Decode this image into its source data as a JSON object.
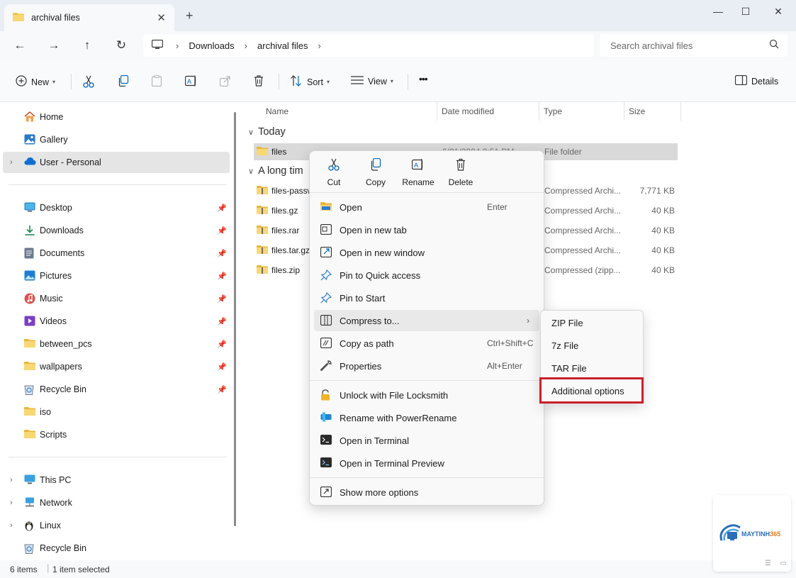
{
  "window": {
    "tab_title": "archival files",
    "new_tab": "+",
    "minimize": "—",
    "maximize": "☐",
    "close": "✕"
  },
  "address": {
    "crumbs": [
      "Downloads",
      "archival files"
    ],
    "search_placeholder": "Search archival files"
  },
  "toolbar": {
    "new_label": "New",
    "sort_label": "Sort",
    "view_label": "View",
    "more_label": "•••",
    "details_label": "Details"
  },
  "sidebar": {
    "top": [
      {
        "label": "Home",
        "icon": "home-icon"
      },
      {
        "label": "Gallery",
        "icon": "gallery-icon"
      },
      {
        "label": "User - Personal",
        "icon": "cloud-icon"
      }
    ],
    "pinned": [
      {
        "label": "Desktop",
        "icon": "desktop-icon"
      },
      {
        "label": "Downloads",
        "icon": "download-icon"
      },
      {
        "label": "Documents",
        "icon": "document-icon"
      },
      {
        "label": "Pictures",
        "icon": "pictures-icon"
      },
      {
        "label": "Music",
        "icon": "music-icon"
      },
      {
        "label": "Videos",
        "icon": "videos-icon"
      },
      {
        "label": "between_pcs",
        "icon": "folder-icon"
      },
      {
        "label": "wallpapers",
        "icon": "folder-icon"
      },
      {
        "label": "Recycle Bin",
        "icon": "recycle-bin-icon"
      },
      {
        "label": "iso",
        "icon": "folder-icon"
      },
      {
        "label": "Scripts",
        "icon": "folder-icon"
      }
    ],
    "bottom": [
      {
        "label": "This PC",
        "icon": "pc-icon"
      },
      {
        "label": "Network",
        "icon": "network-icon"
      },
      {
        "label": "Linux",
        "icon": "linux-icon"
      },
      {
        "label": "Recycle Bin",
        "icon": "recycle-bin-icon"
      }
    ]
  },
  "columns": {
    "name": "Name",
    "date": "Date modified",
    "type": "Type",
    "size": "Size"
  },
  "groups": {
    "today": "Today",
    "long_ago": "A long tim"
  },
  "files": {
    "today": [
      {
        "name": "files",
        "date": "6/21/2024 3:51 PM",
        "type": "File folder",
        "size": ""
      }
    ],
    "older": [
      {
        "name": "files-passw",
        "type": "Compressed Archi...",
        "size": "7,771 KB"
      },
      {
        "name": "files.gz",
        "type": "Compressed Archi...",
        "size": "40 KB"
      },
      {
        "name": "files.rar",
        "type": "Compressed Archi...",
        "size": "40 KB"
      },
      {
        "name": "files.tar.gz",
        "type": "Compressed Archi...",
        "size": "40 KB"
      },
      {
        "name": "files.zip",
        "type": "Compressed (zipp...",
        "size": "40 KB"
      }
    ]
  },
  "status": {
    "items": "6 items",
    "selected": "1 item selected"
  },
  "context_menu": {
    "quick": [
      {
        "label": "Cut",
        "icon": "cut-icon"
      },
      {
        "label": "Copy",
        "icon": "copy-icon"
      },
      {
        "label": "Rename",
        "icon": "rename-icon"
      },
      {
        "label": "Delete",
        "icon": "delete-icon"
      }
    ],
    "group1": [
      {
        "label": "Open",
        "shortcut": "Enter",
        "icon": "open-folder-icon"
      },
      {
        "label": "Open in new tab",
        "shortcut": "",
        "icon": "new-tab-icon"
      },
      {
        "label": "Open in new window",
        "shortcut": "",
        "icon": "new-window-icon"
      },
      {
        "label": "Pin to Quick access",
        "shortcut": "",
        "icon": "pin-icon"
      },
      {
        "label": "Pin to Start",
        "shortcut": "",
        "icon": "pin-icon"
      },
      {
        "label": "Compress to...",
        "shortcut": "",
        "icon": "compress-icon"
      },
      {
        "label": "Copy as path",
        "shortcut": "Ctrl+Shift+C",
        "icon": "copy-path-icon"
      },
      {
        "label": "Properties",
        "shortcut": "Alt+Enter",
        "icon": "properties-icon"
      }
    ],
    "group2": [
      {
        "label": "Unlock with File Locksmith",
        "icon": "lock-icon"
      },
      {
        "label": "Rename with PowerRename",
        "icon": "power-rename-icon"
      },
      {
        "label": "Open in Terminal",
        "icon": "terminal-icon"
      },
      {
        "label": "Open in Terminal Preview",
        "icon": "terminal-preview-icon"
      }
    ],
    "show_more": "Show more options"
  },
  "submenu": [
    "ZIP File",
    "7z File",
    "TAR File",
    "Additional options"
  ],
  "watermark": {
    "brand_main": "MAYTINH",
    "brand_accent": "365"
  },
  "colors": {
    "accent": "#0067c0",
    "folder": "#f3c34a",
    "highlight": "#c8202a"
  }
}
